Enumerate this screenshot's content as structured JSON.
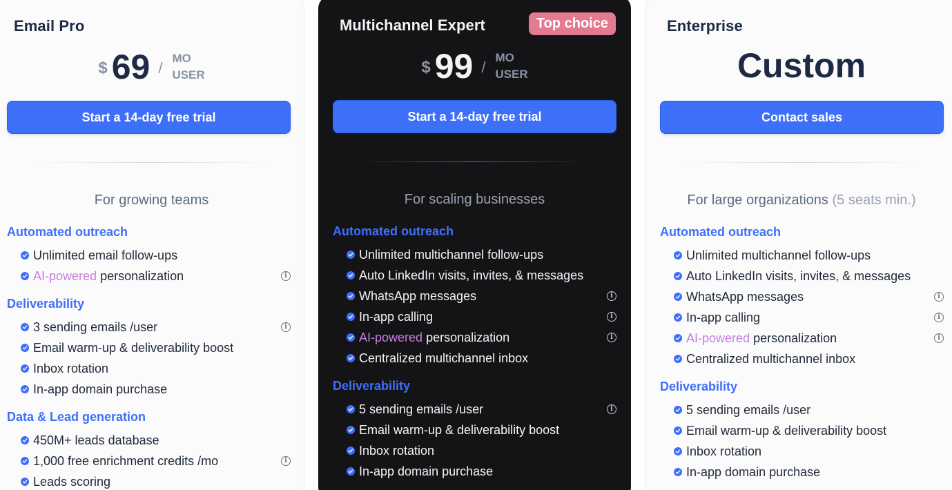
{
  "plans": [
    {
      "name": "Email Pro",
      "currency": "$",
      "amount": "69",
      "slash": "/",
      "unit_top": "MO",
      "unit_bottom": "USER",
      "cta": "Start a 14-day free trial",
      "audience": "For growing teams",
      "sections": [
        {
          "title": "Automated outreach",
          "features": [
            {
              "text": "Unlimited email follow-ups",
              "info": false
            },
            {
              "prefix": "AI-powered",
              "text": " personalization",
              "info": true
            }
          ]
        },
        {
          "title": "Deliverability",
          "features": [
            {
              "text": "3 sending emails /user",
              "info": true
            },
            {
              "text": "Email warm-up & deliverability boost",
              "info": false
            },
            {
              "text": "Inbox rotation",
              "info": false
            },
            {
              "text": "In-app domain purchase",
              "info": false
            }
          ]
        },
        {
          "title": "Data & Lead generation",
          "features": [
            {
              "text": "450M+ leads database",
              "info": false
            },
            {
              "text": "1,000 free enrichment credits /mo",
              "info": true
            },
            {
              "text": "Leads scoring",
              "info": false
            }
          ]
        }
      ]
    },
    {
      "name": "Multichannel Expert",
      "badge": "Top choice",
      "currency": "$",
      "amount": "99",
      "slash": "/",
      "unit_top": "MO",
      "unit_bottom": "USER",
      "cta": "Start a 14-day free trial",
      "audience": "For scaling businesses",
      "sections": [
        {
          "title": "Automated outreach",
          "features": [
            {
              "text": "Unlimited multichannel follow-ups",
              "info": false
            },
            {
              "text": "Auto LinkedIn visits, invites, & messages",
              "info": false
            },
            {
              "text": "WhatsApp messages",
              "info": true
            },
            {
              "text": "In-app calling",
              "info": true
            },
            {
              "prefix": "AI-powered",
              "text": " personalization",
              "info": true
            },
            {
              "text": "Centralized multichannel inbox",
              "info": false
            }
          ]
        },
        {
          "title": "Deliverability",
          "features": [
            {
              "text": "5 sending emails /user",
              "info": true
            },
            {
              "text": "Email warm-up & deliverability boost",
              "info": false
            },
            {
              "text": "Inbox rotation",
              "info": false
            },
            {
              "text": "In-app domain purchase",
              "info": false
            }
          ]
        }
      ]
    },
    {
      "name": "Enterprise",
      "custom": "Custom",
      "cta": "Contact sales",
      "audience": "For large organizations",
      "audience_note": "(5 seats min.)",
      "sections": [
        {
          "title": "Automated outreach",
          "features": [
            {
              "text": "Unlimited multichannel follow-ups",
              "info": false
            },
            {
              "text": "Auto LinkedIn visits, invites, & messages",
              "info": false
            },
            {
              "text": "WhatsApp messages",
              "info": true
            },
            {
              "text": "In-app calling",
              "info": true
            },
            {
              "prefix": "AI-powered",
              "text": " personalization",
              "info": true
            },
            {
              "text": "Centralized multichannel inbox",
              "info": false
            }
          ]
        },
        {
          "title": "Deliverability",
          "features": [
            {
              "text": "5 sending emails /user",
              "info": false
            },
            {
              "text": "Email warm-up & deliverability boost",
              "info": false
            },
            {
              "text": "Inbox rotation",
              "info": false
            },
            {
              "text": "In-app domain purchase",
              "info": false
            }
          ]
        }
      ]
    }
  ],
  "info_glyph": "i",
  "colors": {
    "accent": "#3e6ff9",
    "badge": "#e47a90",
    "ai_text": "#c77ddb",
    "dark_card": "#141417",
    "heading": "#1e2a44"
  }
}
